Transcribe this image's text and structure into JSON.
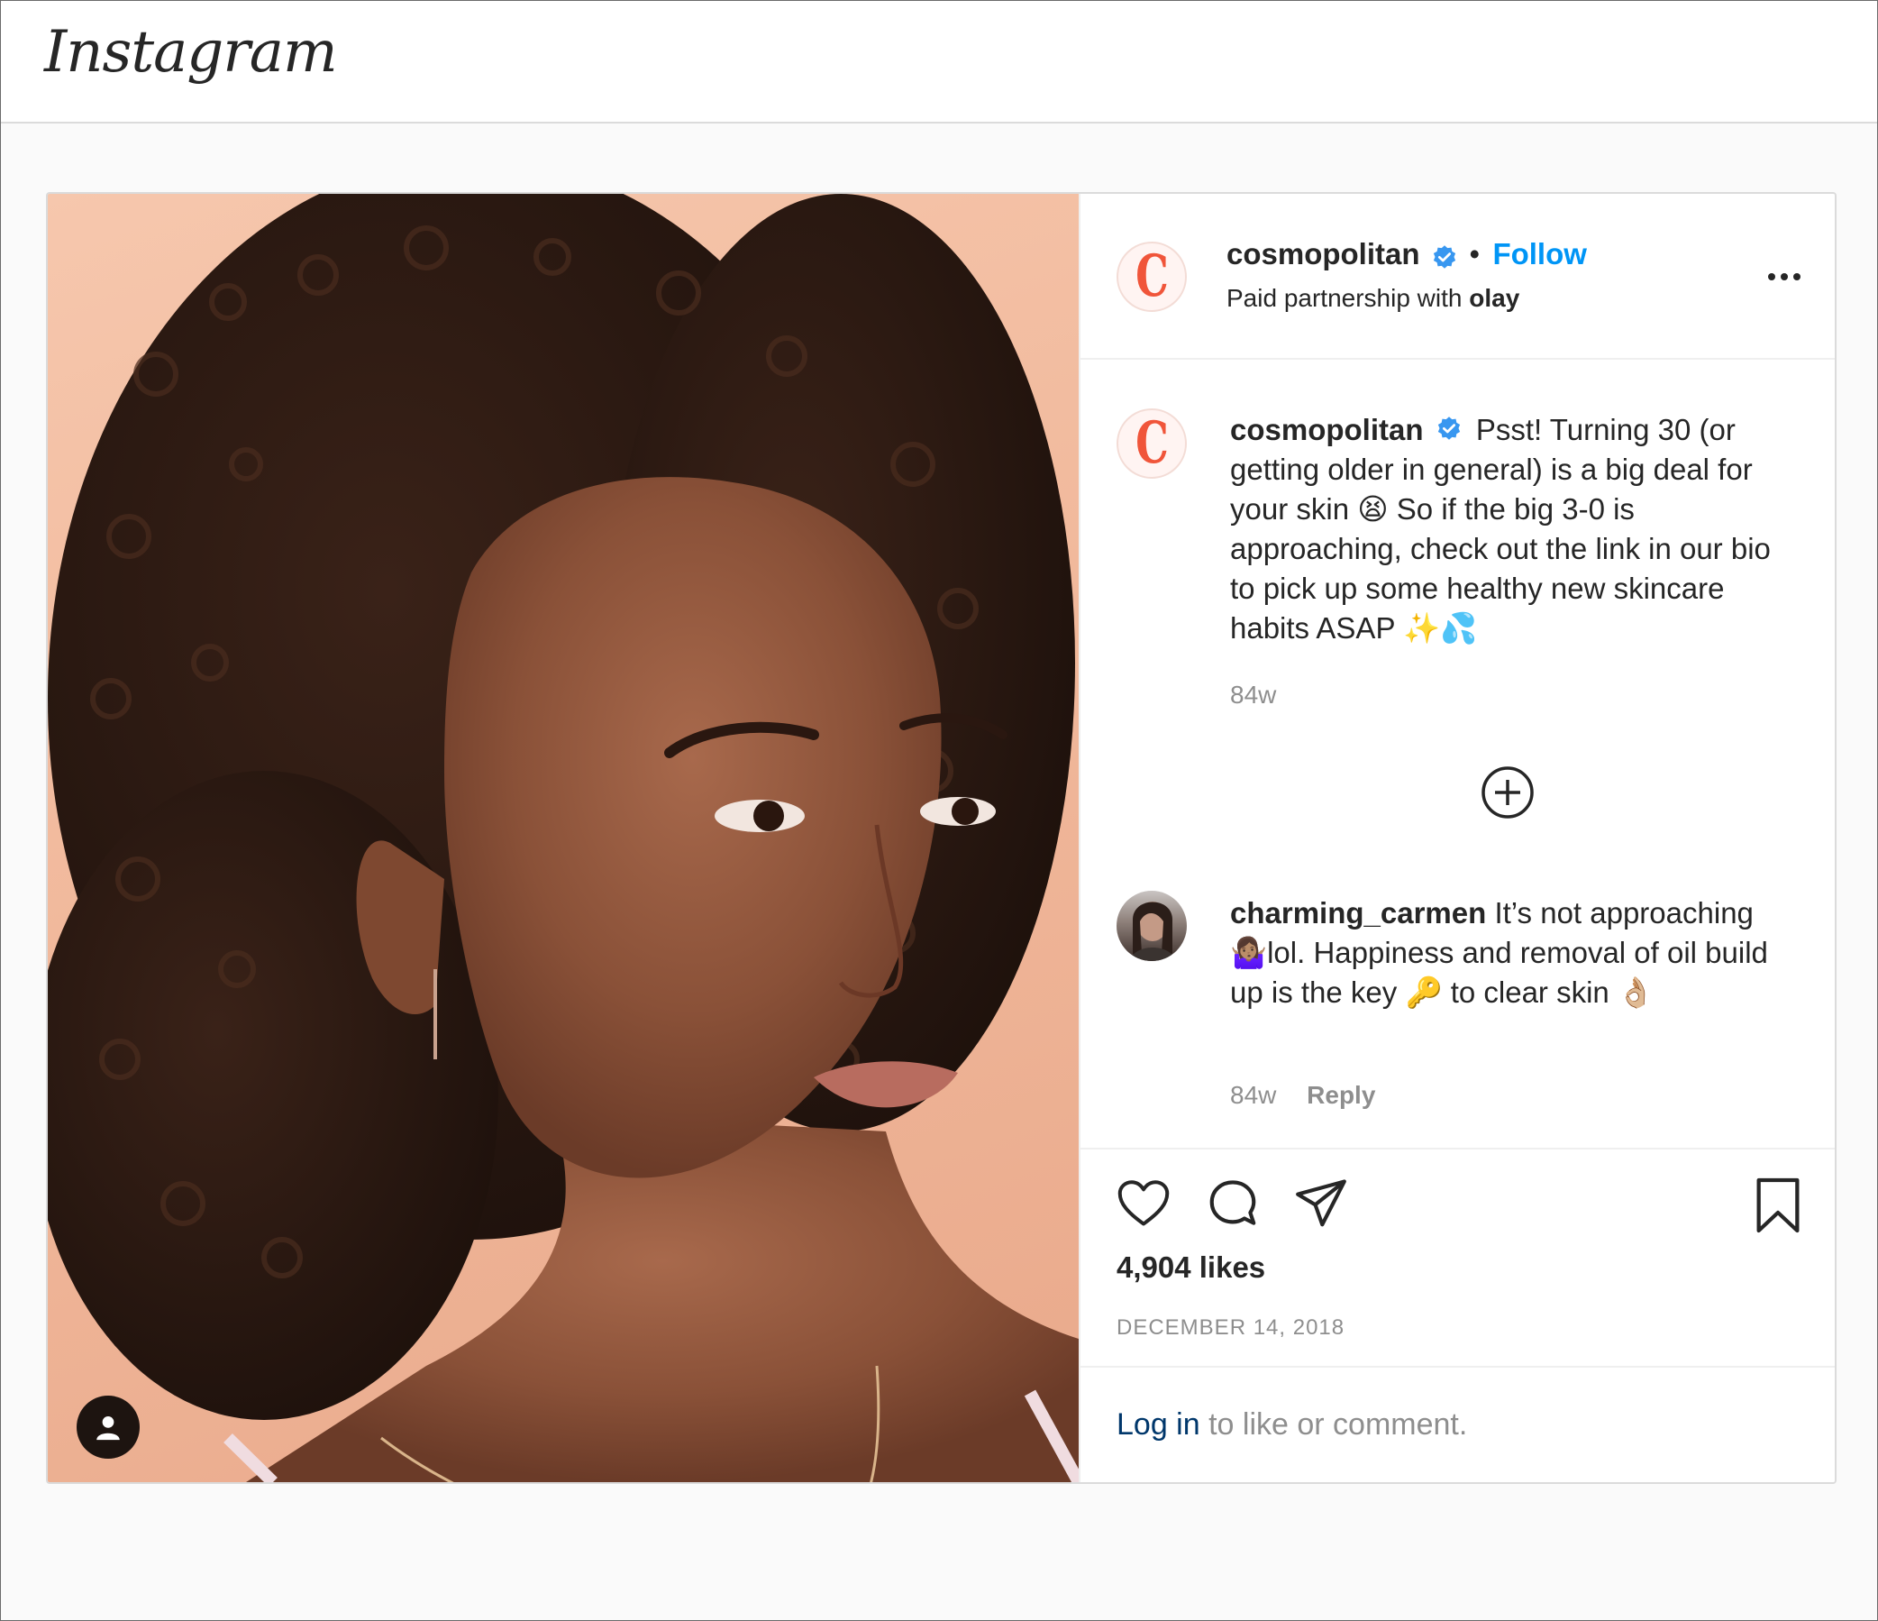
{
  "app": {
    "logo": "Instagram"
  },
  "post": {
    "author": {
      "username": "cosmopolitan",
      "avatar_letter": "C",
      "follow_label": "Follow",
      "partnership_prefix": "Paid partnership with ",
      "partner": "olay"
    },
    "caption": {
      "username": "cosmopolitan",
      "text": "Psst! Turning 30 (or getting older in general) is a big deal for your skin 😫 So if the big 3-0 is approaching, check out the link in our bio to pick up some healthy new skincare habits ASAP ✨💦",
      "time": "84w"
    },
    "load_more_label": "⊕",
    "comments": [
      {
        "username": "charming_carmen",
        "text": "It’s not approaching🤷🏽‍♀️lol. Happiness and removal of oil build up is the key 🔑 to clear skin 👌🏼",
        "time": "84w",
        "reply_label": "Reply"
      }
    ],
    "likes": "4,904 likes",
    "date": "DECEMBER 14, 2018",
    "login_link": "Log in",
    "login_suffix": " to like or comment."
  },
  "colors": {
    "accent_blue": "#0095f6",
    "brand_red": "#f0553a",
    "link_dark_blue": "#00376b",
    "muted_gray": "#8e8e8e"
  },
  "icons": {
    "like": "heart-icon",
    "comment": "speech-bubble-icon",
    "share": "paper-plane-icon",
    "save": "bookmark-icon",
    "more": "ellipsis-icon",
    "verified": "verified-badge-icon",
    "load_more": "plus-circle-icon",
    "tagged_user": "user-tag-icon"
  }
}
